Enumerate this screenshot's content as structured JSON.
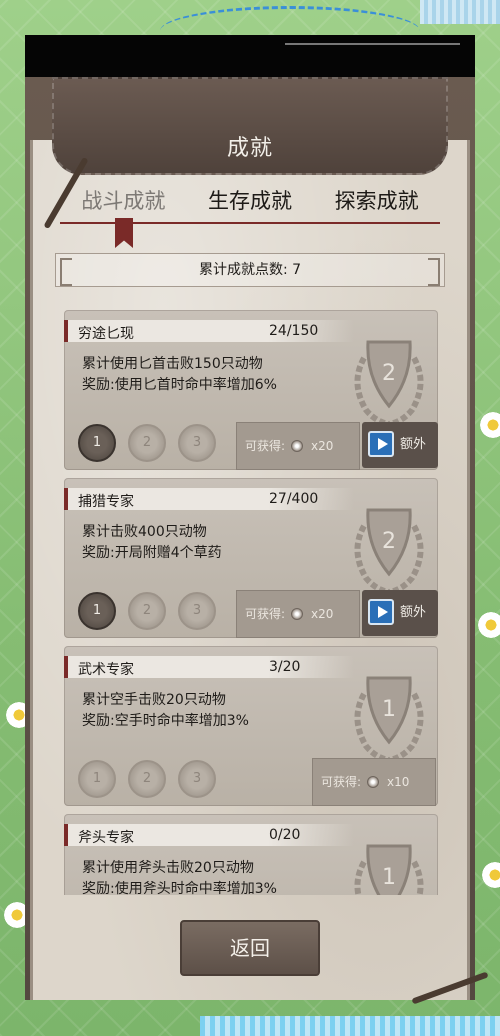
{
  "header": {
    "title": "成就"
  },
  "tabs": [
    {
      "label": "战斗成就",
      "active": true
    },
    {
      "label": "生存成就",
      "active": false
    },
    {
      "label": "探索成就",
      "active": false
    }
  ],
  "points_label": "累计成就点数: 7",
  "achievements": [
    {
      "name": "穷途匕现",
      "progress": "24/150",
      "desc": "累计使用匕首击败150只动物",
      "reward_desc": "奖励:使用匕首时命中率增加6%",
      "emblem": "2",
      "tiers": [
        "1",
        "2",
        "3"
      ],
      "tier_level": 1,
      "obtain_label": "可获得:",
      "obtain_count": "x20",
      "extra_label": "额外"
    },
    {
      "name": "捕猎专家",
      "progress": "27/400",
      "desc": "累计击败400只动物",
      "reward_desc": "奖励:开局附赠4个草药",
      "emblem": "2",
      "tiers": [
        "1",
        "2",
        "3"
      ],
      "tier_level": 1,
      "obtain_label": "可获得:",
      "obtain_count": "x20",
      "extra_label": "额外"
    },
    {
      "name": "武术专家",
      "progress": "3/20",
      "desc": "累计空手击败20只动物",
      "reward_desc": "奖励:空手时命中率增加3%",
      "emblem": "1",
      "tiers": [
        "1",
        "2",
        "3"
      ],
      "tier_level": 0,
      "obtain_label": "可获得:",
      "obtain_count": "x10"
    },
    {
      "name": "斧头专家",
      "progress": "0/20",
      "desc": "累计使用斧头击败20只动物",
      "reward_desc": "奖励:使用斧头时命中率增加3%",
      "emblem": "1"
    }
  ],
  "back_label": "返回",
  "colors": {
    "accent": "#7a2a28",
    "paper": "#ddd6cb",
    "card": "#c2bab0",
    "leather": "#5e4f47"
  }
}
